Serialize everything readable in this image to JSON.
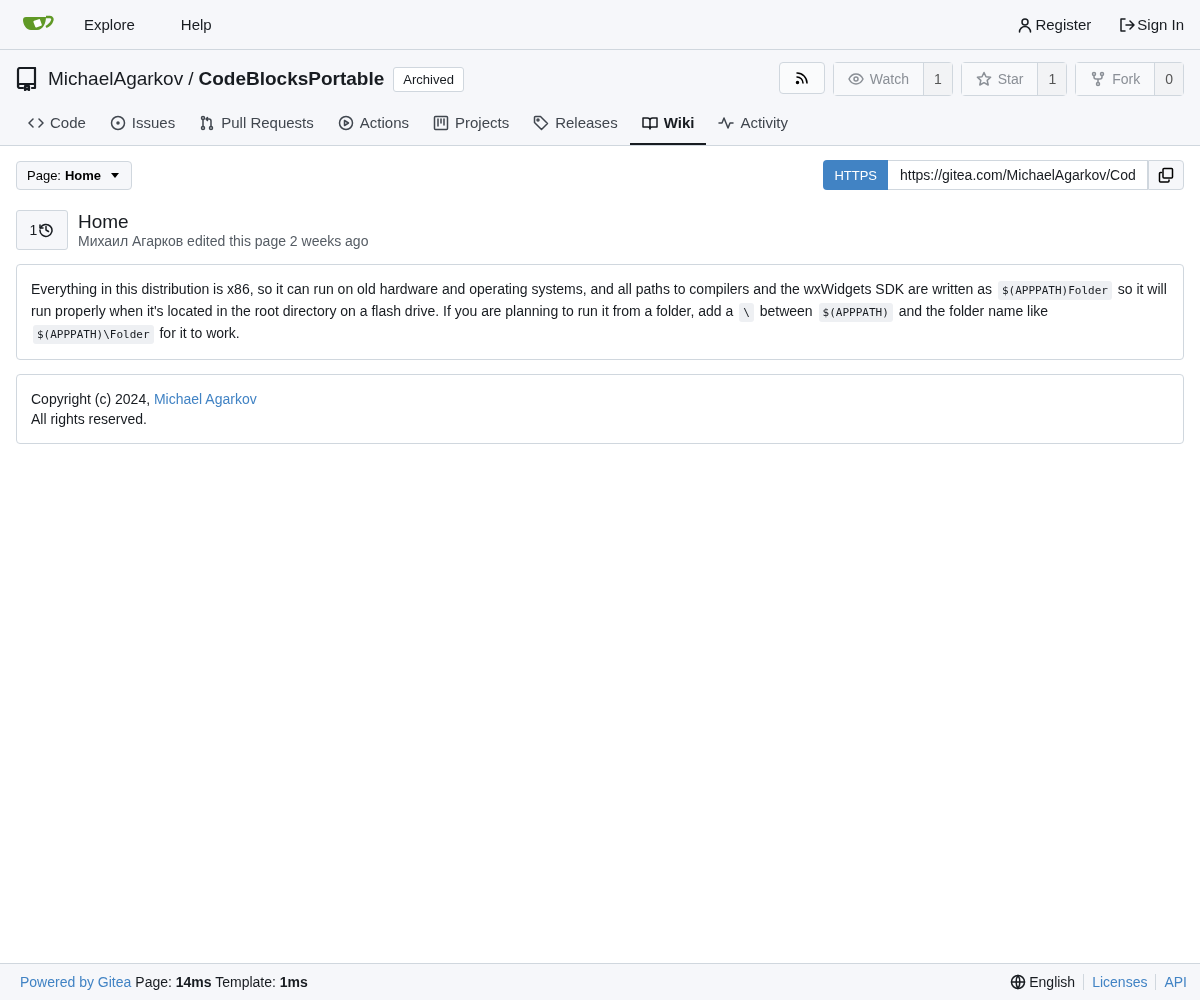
{
  "navbar": {
    "links": [
      "Explore",
      "Help"
    ],
    "right_links": [
      "Register",
      "Sign In"
    ]
  },
  "repo": {
    "owner": "MichaelAgarkov",
    "separator": "/",
    "name": "CodeBlocksPortable",
    "badge": "Archived",
    "actions": [
      {
        "label": "Watch",
        "count": "1"
      },
      {
        "label": "Star",
        "count": "1"
      },
      {
        "label": "Fork",
        "count": "0"
      }
    ]
  },
  "tabs": [
    {
      "label": "Code",
      "selected": false
    },
    {
      "label": "Issues",
      "selected": false
    },
    {
      "label": "Pull Requests",
      "selected": false
    },
    {
      "label": "Actions",
      "selected": false
    },
    {
      "label": "Projects",
      "selected": false
    },
    {
      "label": "Releases",
      "selected": false
    },
    {
      "label": "Wiki",
      "selected": true
    },
    {
      "label": "Activity",
      "selected": false
    }
  ],
  "page_selector": {
    "prefix": "Page:",
    "value": "Home"
  },
  "clone": {
    "protocol": "HTTPS",
    "url": "https://gitea.com/MichaelAgarkov/Cod"
  },
  "wiki_page": {
    "revisions": "1",
    "title": "Home",
    "meta": "Михаил Агарков edited this page 2 weeks ago"
  },
  "content": [
    {
      "kind": "text",
      "text": "Everything in this distribution is x86, so it can run on old hardware and operating systems, and all paths to compilers and the wxWidgets SDK are written as "
    },
    {
      "kind": "code",
      "text": "$(APPPATH)Folder"
    },
    {
      "kind": "text",
      "text": " so it will run properly when it's located in the root directory on a flash drive. If you are planning to run it from a folder, add a "
    },
    {
      "kind": "code",
      "text": "\\"
    },
    {
      "kind": "text",
      "text": " between "
    },
    {
      "kind": "code",
      "text": "$(APPPATH)"
    },
    {
      "kind": "text",
      "text": " and the folder name like "
    },
    {
      "kind": "code",
      "text": "$(APPPATH)\\Folder"
    },
    {
      "kind": "text",
      "text": " for it to work."
    }
  ],
  "footer_box": {
    "copyright": "Copyright (c) 2024,",
    "author_link": "Michael Agarkov",
    "rights": "All rights reserved."
  },
  "footer": {
    "powered_by": "Powered by Gitea",
    "timing": "Page: **14ms** Template: **1ms**",
    "language": "English",
    "links": [
      "Licenses",
      "API"
    ]
  }
}
